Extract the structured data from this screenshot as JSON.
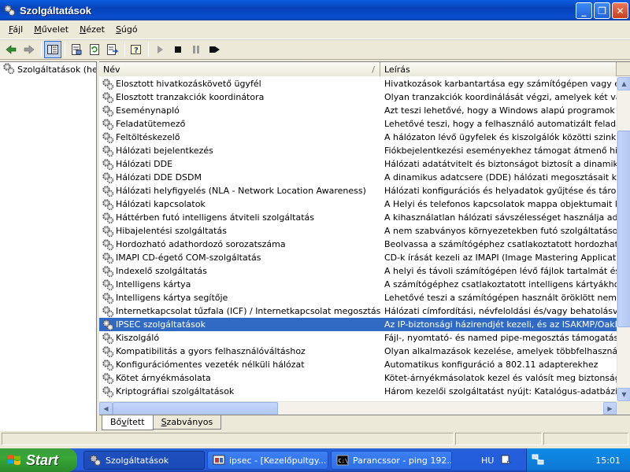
{
  "window": {
    "title": "Szolgáltatások",
    "buttons": {
      "minimize": "_",
      "maximize": "❐",
      "close": "✕"
    }
  },
  "menu": [
    {
      "label": "Fájl",
      "accel": "F"
    },
    {
      "label": "Művelet",
      "accel": "M"
    },
    {
      "label": "Nézet",
      "accel": "N"
    },
    {
      "label": "Súgó",
      "accel": "S"
    }
  ],
  "toolbar": {
    "icons": [
      "back-icon",
      "forward-icon",
      "show-hide-tree-icon",
      "properties-icon",
      "refresh-icon",
      "export-list-icon",
      "help-icon",
      "start-service-icon",
      "stop-service-icon",
      "pause-service-icon",
      "restart-service-icon"
    ]
  },
  "tree": {
    "root_label": "Szolgáltatások (helyi)"
  },
  "list": {
    "col_name": "Név",
    "col_desc": "Leírás",
    "sort_indicator": "/",
    "rows": [
      {
        "name": "Elosztott hivatkozáskövető ügyfél",
        "desc": "Hivatkozások karbantartása egy számítógépen vagy egy tart"
      },
      {
        "name": "Elosztott tranzakciók koordinátora",
        "desc": "Olyan tranzakciók koordinálását végzi, amelyek két vagy több"
      },
      {
        "name": "Eseménynapló",
        "desc": "Azt teszi lehetővé, hogy a Windows alapú programok és össz"
      },
      {
        "name": "Feladatütemező",
        "desc": "Lehetővé teszi, hogy a felhasználó automatizált feladatokat h"
      },
      {
        "name": "Feltöltéskezelő",
        "desc": "A hálózaton lévő ügyfelek és kiszolgálók közötti szinkron és a"
      },
      {
        "name": "Hálózati bejelentkezés",
        "desc": "Fiókbejelentkezési eseményekhez támogat átmenő hitelesítés"
      },
      {
        "name": "Hálózati DDE",
        "desc": "Hálózati adatátvitelt és biztonságot biztosít a dinamikus adatc"
      },
      {
        "name": "Hálózati DDE DSDM",
        "desc": "A dinamikus adatcsere (DDE) hálózati megosztásait kezeli. Ha"
      },
      {
        "name": "Hálózati helyfigyelés (NLA - Network Location Awareness)",
        "desc": "Hálózati konfigurációs és helyadatok gyűjtése és tárolása, va"
      },
      {
        "name": "Hálózati kapcsolatok",
        "desc": "A Helyi és telefonos kapcsolatok mappa objektumait kezeli"
      },
      {
        "name": "Háttérben futó intelligens átviteli szolgáltatás",
        "desc": "A kihasználatlan hálózati sávszélességet használja adatátvite"
      },
      {
        "name": "Hibajelentési szolgáltatás",
        "desc": "A nem szabványos környezetekben futó szolgáltatásokhoz és"
      },
      {
        "name": "Hordozható adathordozó sorozatszáma",
        "desc": "Beolvassa a számítógéphez csatlakoztatott hordozható zenel"
      },
      {
        "name": "IMAPI CD-égető COM-szolgáltatás",
        "desc": "CD-k írását kezeli az IMAPI (Image Mastering Applications Pro"
      },
      {
        "name": "Indexelő szolgáltatás",
        "desc": "A helyi és távoli számítógépen lévő fájlok tartalmát és tulajdo"
      },
      {
        "name": "Intelligens kártya",
        "desc": "A számítógéphez csatlakoztatott intelligens kártyákhoz törté"
      },
      {
        "name": "Intelligens kártya segítője",
        "desc": "Lehetővé teszi a számítógépen használt öröklött nem plug and"
      },
      {
        "name": "Internetkapcsolat tűzfala (ICF) / Internetkapcsolat megosztása (ICS)",
        "desc": "Hálózati címfordítási, névfeloldási és/vagy behatolásvédelmi s"
      },
      {
        "name": "IPSEC szolgáltatások",
        "desc": "Az IP-biztonsági házirendjét kezeli, és az ISAKMP/Oakley (IKE",
        "selected": true
      },
      {
        "name": "Kiszolgáló",
        "desc": "Fájl-, nyomtató- és named pipe-megosztás támogatása a háló"
      },
      {
        "name": "Kompatibilitás a gyors felhasználóváltáshoz",
        "desc": "Olyan alkalmazások kezelése, amelyek többfelhasználós körny"
      },
      {
        "name": "Konfigurációmentes vezeték nélküli hálózat",
        "desc": "Automatikus konfiguráció a 802.11 adapterekhez"
      },
      {
        "name": "Kötet árnyékmásolata",
        "desc": "Kötet-árnyékmásolatok kezel és valósít meg biztonsági más"
      },
      {
        "name": "Kriptográfiai szolgáltatások",
        "desc": "Három kezelői szolgáltatást nyújt: Katalógus-adatbázis szolgá"
      }
    ]
  },
  "tabs": [
    {
      "label": "Bővített",
      "accel_index": 2,
      "active": true
    },
    {
      "label": "Szabványos",
      "accel_index": 0,
      "active": false
    }
  ],
  "taskbar": {
    "start_label": "Start",
    "tasks": [
      {
        "label": "Szolgáltatások",
        "icon": "services-gear-icon",
        "active": true
      },
      {
        "label": "ipsec - [Kezelőpultgy...",
        "icon": "mmc-icon",
        "active": false
      },
      {
        "label": "Parancssor - ping 192....",
        "icon": "command-prompt-icon",
        "active": false
      }
    ],
    "language": "HU",
    "clock": "15:01"
  },
  "colors": {
    "selection": "#316ac5",
    "titlebar": "#0a4fd0",
    "start_green": "#38a738"
  }
}
